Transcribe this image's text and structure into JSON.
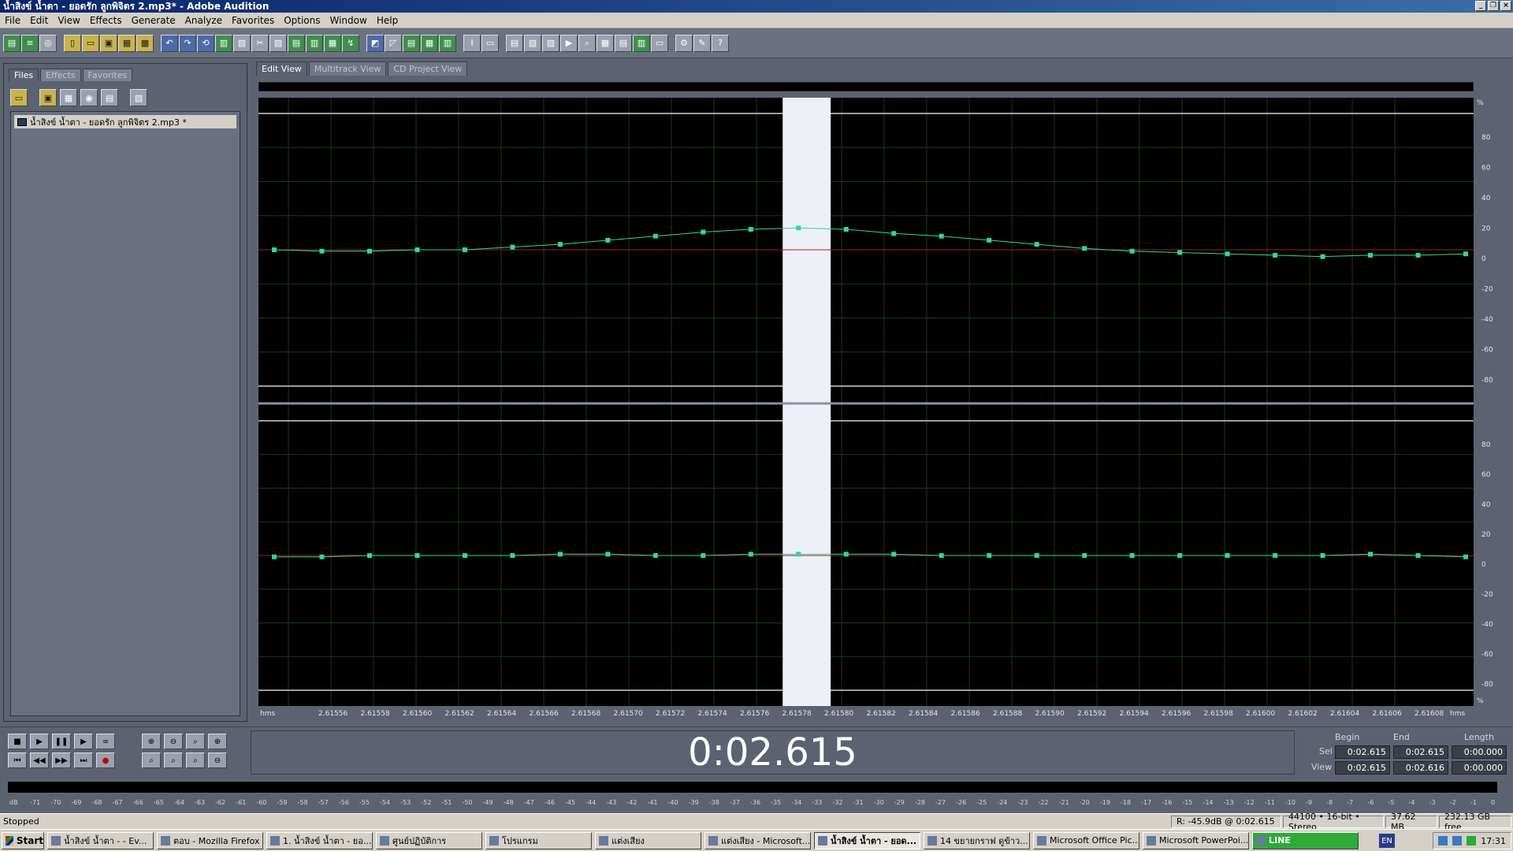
{
  "window": {
    "title": "น้ำสิงข์ น้ำตา - ยอดรัก ลูกพิจิตร 2.mp3* - Adobe Audition"
  },
  "menu": [
    "File",
    "Edit",
    "View",
    "Effects",
    "Generate",
    "Analyze",
    "Favorites",
    "Options",
    "Window",
    "Help"
  ],
  "left_panel": {
    "tabs": [
      "Files",
      "Effects",
      "Favorites"
    ],
    "active_tab": "Files",
    "files": [
      "น้ำสิงข์ น้ำตา - ยอดรัก ลูกพิจิตร 2.mp3 *"
    ]
  },
  "view_tabs": [
    "Edit View",
    "Multitrack View",
    "CD Project View"
  ],
  "active_view": "Edit View",
  "waveform": {
    "time_ticks": [
      "2.61556",
      "2.61558",
      "2.61560",
      "2.61562",
      "2.61564",
      "2.61566",
      "2.61568",
      "2.61570",
      "2.61572",
      "2.61574",
      "2.61576",
      "2.61578",
      "2.61580",
      "2.61582",
      "2.61584",
      "2.61586",
      "2.61588",
      "2.61590",
      "2.61592",
      "2.61594",
      "2.61596",
      "2.61598",
      "2.61600",
      "2.61602",
      "2.61604",
      "2.61606",
      "2.61608"
    ],
    "time_unit_left": "hms",
    "time_unit_right": "hms",
    "amp_unit": "%",
    "amp_ticks": [
      "80",
      "60",
      "40",
      "20",
      "0",
      "-20",
      "-40",
      "-60",
      "-80"
    ],
    "left_channel_values": [
      0,
      -1,
      -1,
      0,
      0,
      2,
      4,
      7,
      10,
      13,
      15,
      16,
      15,
      12,
      10,
      7,
      4,
      1,
      -1,
      -2,
      -3,
      -4,
      -5,
      -4,
      -4,
      -3
    ],
    "right_channel_values": [
      -1,
      -1,
      0,
      0,
      0,
      0,
      1,
      1,
      0,
      0,
      1,
      1,
      1,
      1,
      0,
      0,
      0,
      0,
      0,
      0,
      0,
      0,
      0,
      1,
      0,
      -1
    ],
    "selection_fraction": [
      0.4314,
      0.4709
    ],
    "colors": {
      "waveform": "#2fd6a0",
      "centerline": "#a02020",
      "selection": "#eef0f8",
      "background": "#000000",
      "grid": "#163a1c"
    }
  },
  "time_display": "0:02.615",
  "selection_info": {
    "headers": [
      "Begin",
      "End",
      "Length"
    ],
    "sel_label": "Sel",
    "view_label": "View",
    "sel": [
      "0:02.615",
      "0:02.615",
      "0:00.000"
    ],
    "view": [
      "0:02.615",
      "0:02.616",
      "0:00.000"
    ]
  },
  "level_meter": {
    "ticks": [
      "dB",
      "-71",
      "-70",
      "-69",
      "-68",
      "-67",
      "-66",
      "-65",
      "-64",
      "-63",
      "-62",
      "-61",
      "-60",
      "-59",
      "-58",
      "-57",
      "-56",
      "-55",
      "-54",
      "-53",
      "-52",
      "-51",
      "-50",
      "-49",
      "-48",
      "-47",
      "-46",
      "-45",
      "-44",
      "-43",
      "-42",
      "-41",
      "-40",
      "-39",
      "-38",
      "-37",
      "-36",
      "-35",
      "-34",
      "-33",
      "-32",
      "-31",
      "-30",
      "-29",
      "-28",
      "-27",
      "-26",
      "-25",
      "-24",
      "-23",
      "-22",
      "-21",
      "-20",
      "-19",
      "-18",
      "-17",
      "-16",
      "-15",
      "-14",
      "-13",
      "-12",
      "-11",
      "-10",
      "-9",
      "-8",
      "-7",
      "-6",
      "-5",
      "-4",
      "-3",
      "-2",
      "-1",
      "0"
    ]
  },
  "status": {
    "text": "Stopped",
    "readout": "R: -45.9dB @  0:02.615",
    "format": "44100 • 16-bit • Stereo",
    "size": "37.62 MB",
    "free": "232.13 GB free"
  },
  "taskbar": {
    "start": "Start",
    "tasks": [
      "น้ำสิงข์ น้ำตา - - Ev...",
      "ตอบ - Mozilla Firefox",
      "1. น้ำสิงข์ น้ำตา - ยอ...",
      "ศูนย์ปฏิบัติการ",
      "โปรแกรม",
      "แต่งเสียง",
      "แต่งเสียง - Microsoft...",
      "น้ำสิงข์ น้ำตา - ยอด...",
      "14 ขยายกราฟ ดูข้าว...",
      "Microsoft Office Pic...",
      "Microsoft PowerPoi...",
      "LINE"
    ],
    "active_task": 7,
    "lang": "EN",
    "clock": "17:31"
  }
}
